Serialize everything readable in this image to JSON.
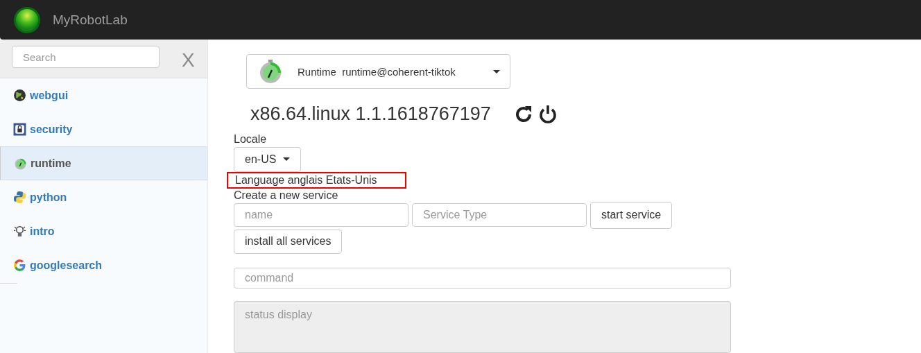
{
  "navbar": {
    "brand": "MyRobotLab"
  },
  "sidebar": {
    "search": {
      "placeholder": "Search"
    },
    "clear": "X",
    "items": [
      {
        "label": "webgui",
        "kind": "globe",
        "selected": false
      },
      {
        "label": "security",
        "kind": "lock",
        "selected": false
      },
      {
        "label": "runtime",
        "kind": "stopwatch",
        "selected": true
      },
      {
        "label": "python",
        "kind": "python",
        "selected": false
      },
      {
        "label": "intro",
        "kind": "bulb",
        "selected": false
      },
      {
        "label": "googlesearch",
        "kind": "google",
        "selected": false
      }
    ]
  },
  "service_select": {
    "type": "Runtime",
    "name": "runtime@coherent-tiktok"
  },
  "platform": "x86.64.linux 1.1.1618767197",
  "locale": {
    "label": "Locale",
    "value": "en-US"
  },
  "language": {
    "text": "Language anglais Etats-Unis",
    "highlighted": true
  },
  "create": {
    "label": "Create a new service",
    "name_placeholder": "name",
    "type_placeholder": "Service Type",
    "start_button": "start service",
    "install_button": "install all services"
  },
  "command": {
    "placeholder": "command"
  },
  "status": {
    "placeholder": "status display"
  }
}
